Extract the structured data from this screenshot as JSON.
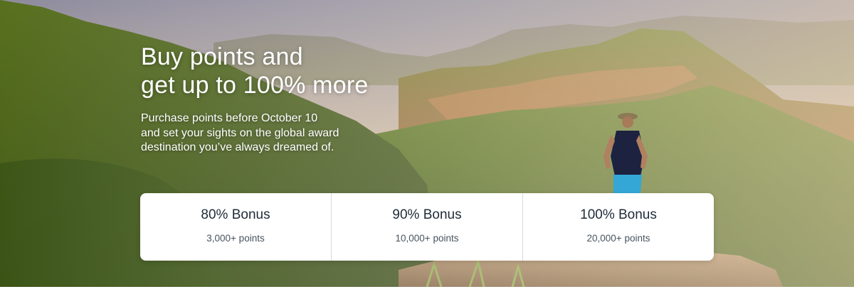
{
  "hero": {
    "headline_line1": "Buy points and",
    "headline_line2": "get up to 100% more",
    "sub_line1": "Purchase points before October 10",
    "sub_line2": "and set your sights on the global award",
    "sub_line3": "destination you’ve always dreamed of."
  },
  "bonuses": [
    {
      "title": "80% Bonus",
      "points": "3,000+ points"
    },
    {
      "title": "90% Bonus",
      "points": "10,000+ points"
    },
    {
      "title": "100% Bonus",
      "points": "20,000+ points"
    }
  ],
  "colors": {
    "headline_text": "#ffffff",
    "card_background": "#ffffff",
    "card_title": "#1e2b38",
    "card_subtext": "#47535e",
    "divider": "#d5dbe0"
  }
}
